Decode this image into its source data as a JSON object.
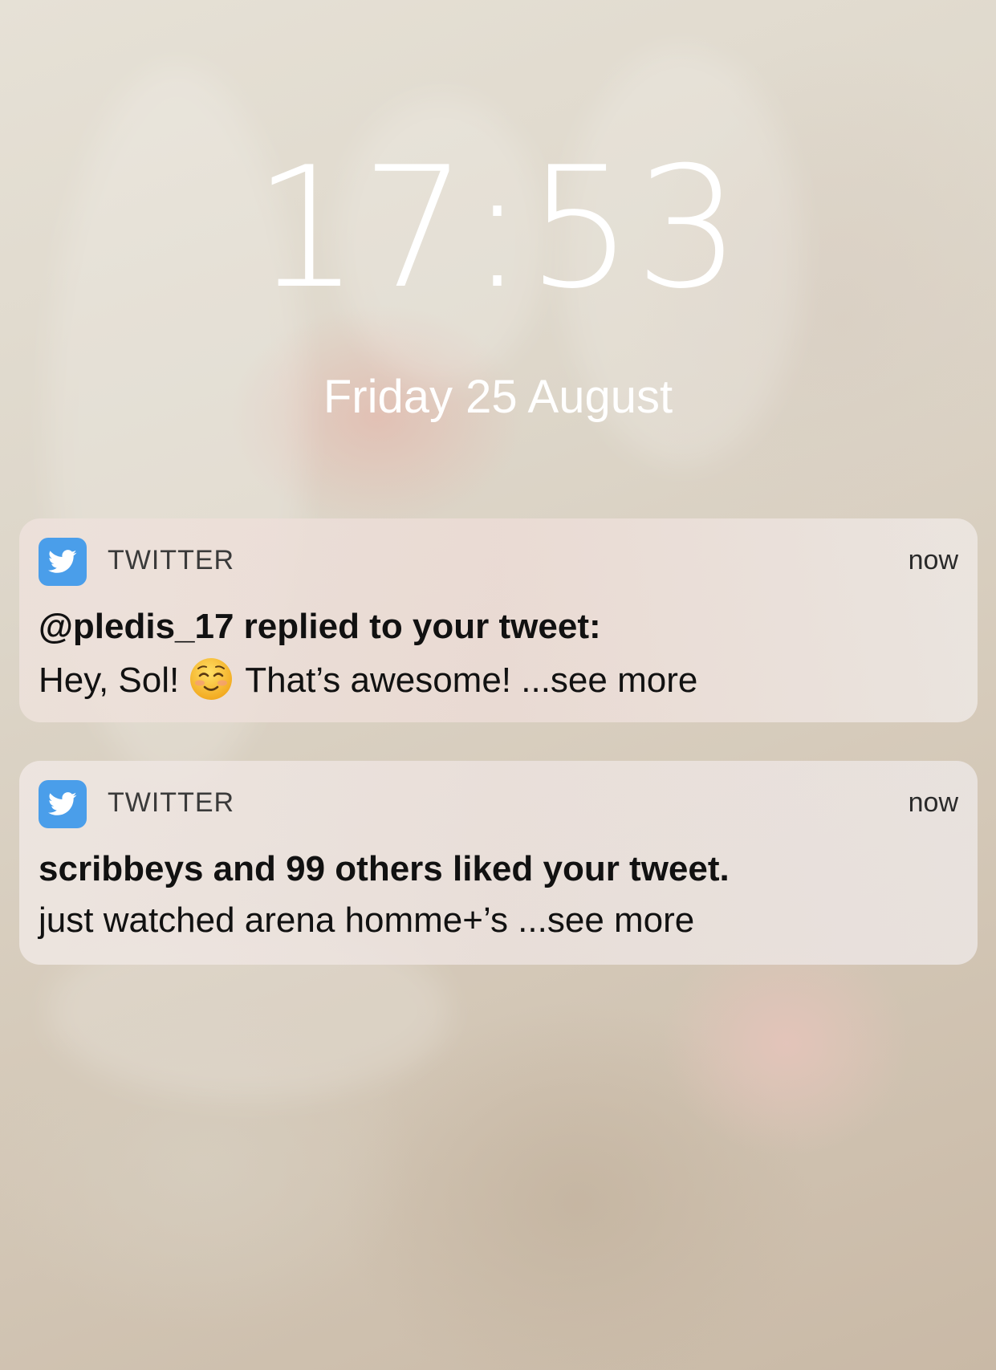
{
  "lockscreen": {
    "time": "17:53",
    "date": "Friday 25 August"
  },
  "notifications": [
    {
      "app_name": "TWITTER",
      "app_icon": "twitter-bird-icon",
      "timestamp": "now",
      "title": "@pledis_17 replied to your tweet:",
      "body_before_emoji": "Hey, Sol!",
      "emoji": "smiling-face-icon",
      "body_after_emoji": "That’s awesome! ...see more"
    },
    {
      "app_name": "TWITTER",
      "app_icon": "twitter-bird-icon",
      "timestamp": "now",
      "title": "scribbeys and 99 others liked your tweet.",
      "body": "just watched arena homme+’s ...see more"
    }
  ],
  "colors": {
    "twitter_blue": "#4a9eea",
    "text_white": "#ffffff",
    "text_dark": "#111111"
  }
}
